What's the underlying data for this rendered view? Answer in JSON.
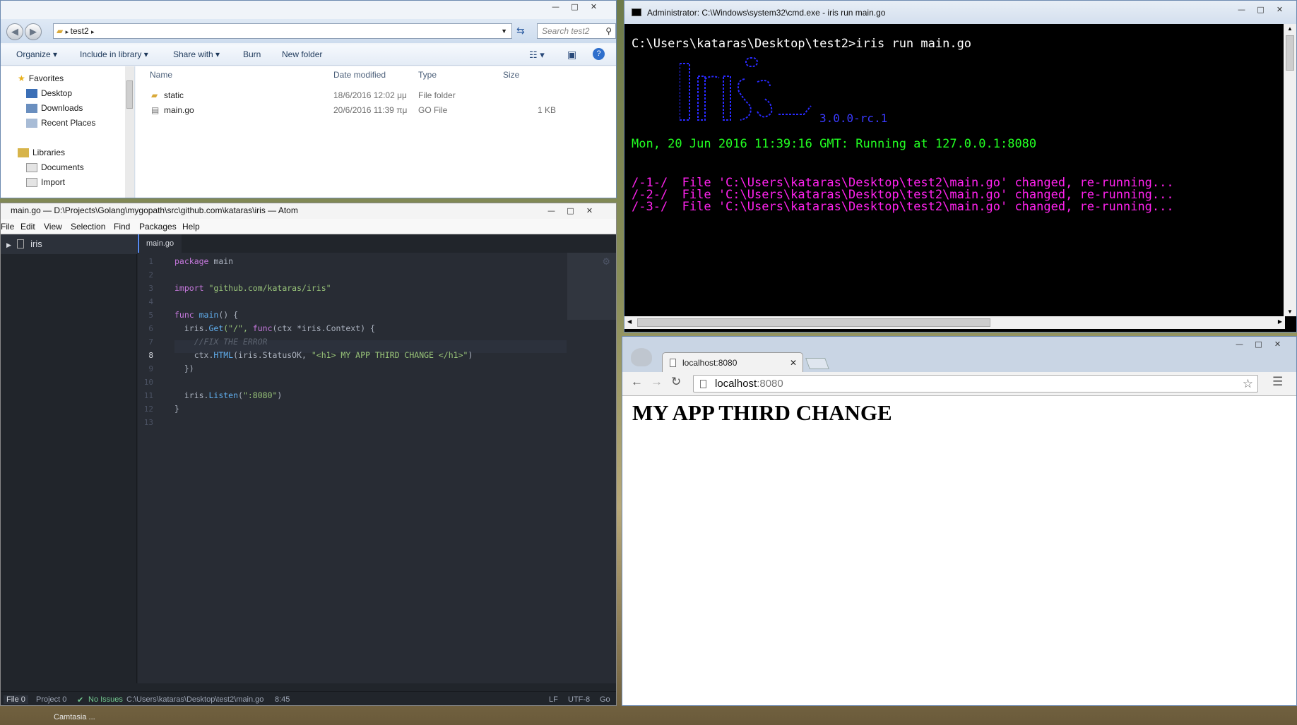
{
  "explorer": {
    "breadcrumb": "test2",
    "search_placeholder": "Search test2",
    "toolbar": [
      "Organize",
      "Include in library",
      "Share with",
      "Burn",
      "New folder"
    ],
    "nav": {
      "favorites": "Favorites",
      "desktop": "Desktop",
      "downloads": "Downloads",
      "recent": "Recent Places",
      "libraries": "Libraries",
      "documents": "Documents",
      "import": "Import"
    },
    "columns": [
      "Name",
      "Date modified",
      "Type",
      "Size"
    ],
    "files": [
      {
        "name": "static",
        "date": "18/6/2016 12:02 μμ",
        "type": "File folder",
        "size": ""
      },
      {
        "name": "main.go",
        "date": "20/6/2016 11:39 πμ",
        "type": "GO File",
        "size": "1 KB"
      }
    ]
  },
  "atom": {
    "title": "main.go — D:\\Projects\\Golang\\mygopath\\src\\github.com\\kataras\\iris — Atom",
    "menu": [
      "File",
      "Edit",
      "View",
      "Selection",
      "Find",
      "Packages",
      "Help"
    ],
    "tree_root": "iris",
    "tab": "main.go",
    "lines": {
      "l1a": "package",
      "l1b": " main",
      "l3a": "import",
      "l3b": " \"github.com/kataras/iris\"",
      "l5a": "func",
      "l5b": " main",
      "l5c": "() {",
      "l6a": "  iris.",
      "l6b": "Get",
      "l6c": "(\"/\", ",
      "l6d": "func",
      "l6e": "(ctx *iris.Context) {",
      "l7": "    //FIX THE ERROR",
      "l8a": "    ctx.",
      "l8b": "HTML",
      "l8c": "(iris.StatusOK, ",
      "l8d": "\"<h1> MY APP THIRD CHANGE </h1>\"",
      "l8e": ")",
      "l9": "  })",
      "l11a": "  iris.",
      "l11b": "Listen",
      "l11c": "(",
      "l11d": "\":8080\"",
      "l11e": ")",
      "l12": "}"
    },
    "status": {
      "file": "File 0",
      "project": "Project 0",
      "issues": "No Issues",
      "path": "C:\\Users\\kataras\\Desktop\\test2\\main.go",
      "cursor": "8:45",
      "eol": "LF",
      "encoding": "UTF-8",
      "grammar": "Go"
    }
  },
  "cmd": {
    "title": "Administrator: C:\\Windows\\system32\\cmd.exe - iris  run main.go",
    "prompt": "C:\\Users\\kataras\\Desktop\\test2>iris run main.go",
    "logo_version": "3.0.0-rc.1",
    "running": "Mon, 20 Jun 2016 11:39:16 GMT: Running at 127.0.0.1:8080",
    "changes": [
      "/-1-/  File 'C:\\Users\\kataras\\Desktop\\test2\\main.go' changed, re-running...",
      "/-2-/  File 'C:\\Users\\kataras\\Desktop\\test2\\main.go' changed, re-running...",
      "/-3-/  File 'C:\\Users\\kataras\\Desktop\\test2\\main.go' changed, re-running..."
    ]
  },
  "chrome": {
    "tab_title": "localhost:8080",
    "url_host": "localhost",
    "url_port": ":8080",
    "heading": "MY APP THIRD CHANGE"
  },
  "taskbar": {
    "label": "Camtasia ..."
  }
}
